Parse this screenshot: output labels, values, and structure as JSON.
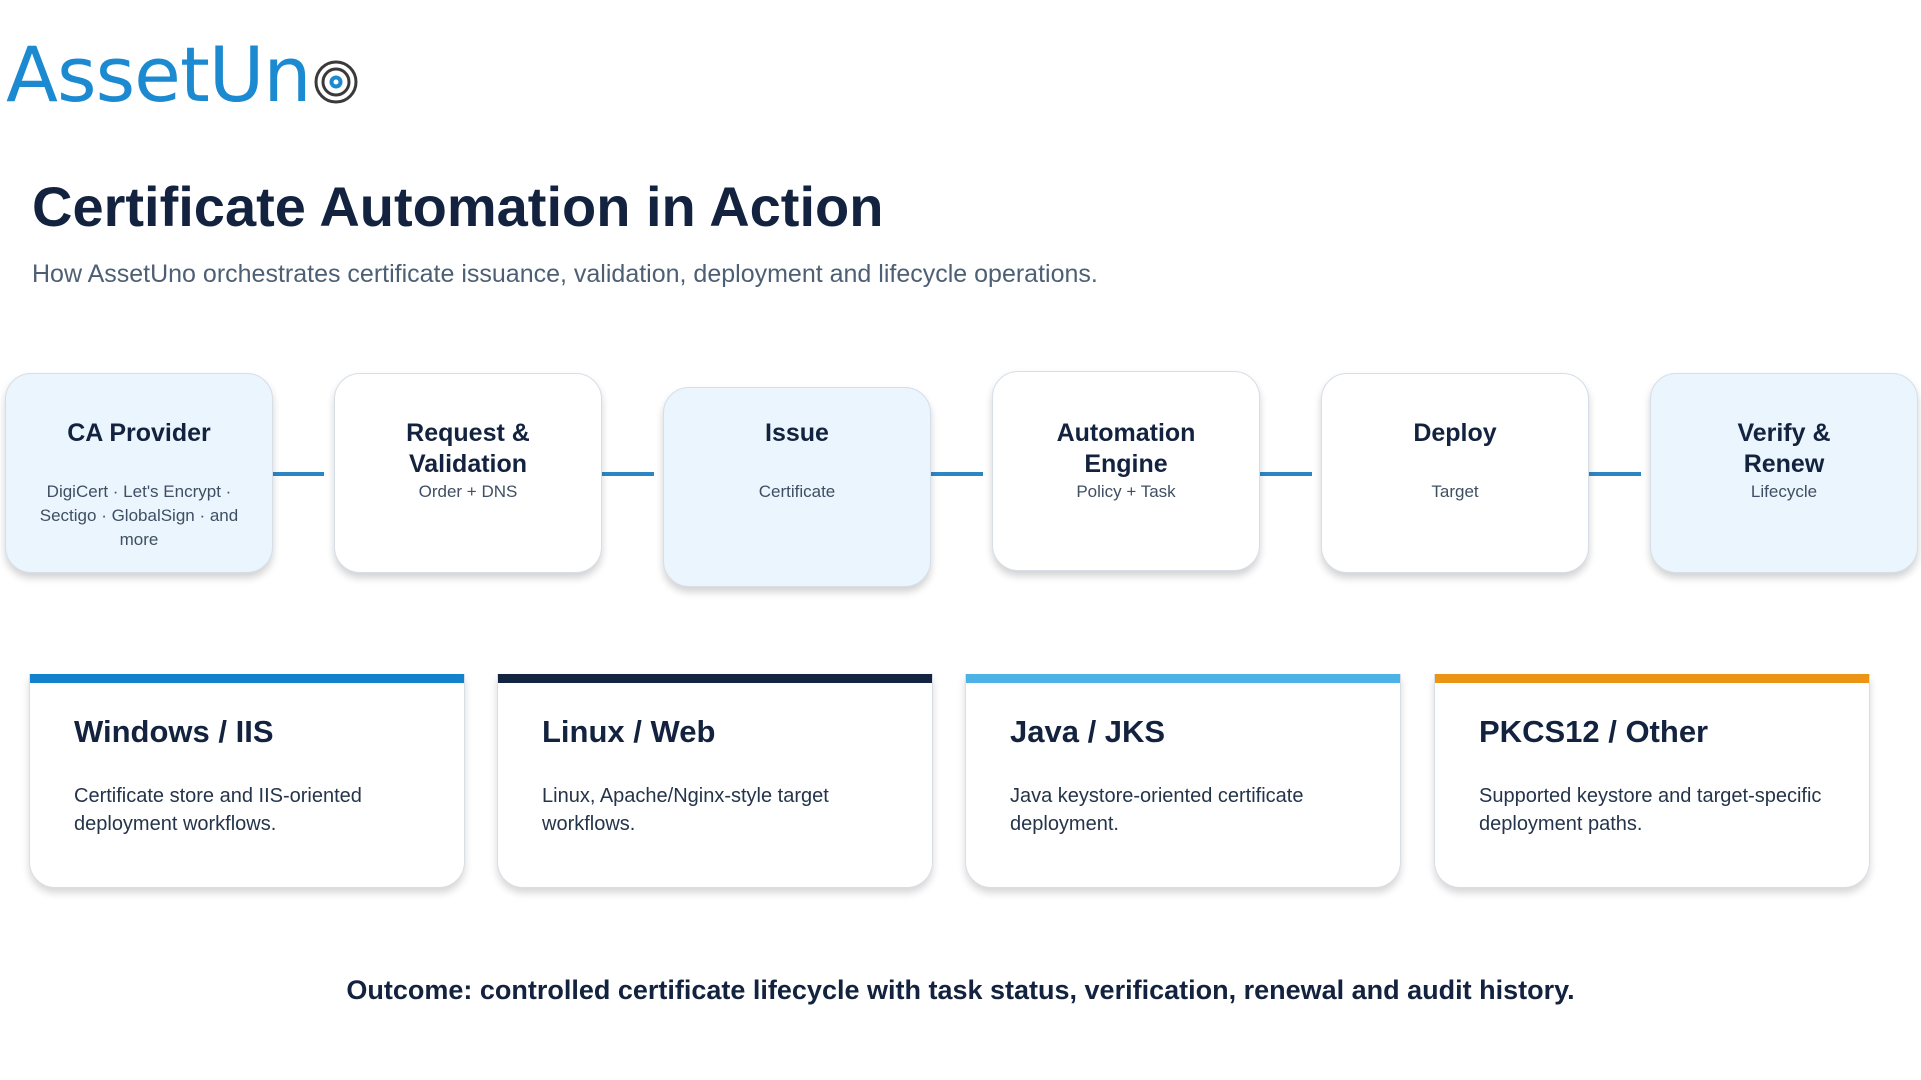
{
  "brand": {
    "logo_text": "AssetUn",
    "logo_mark_icon": "target-rings-icon",
    "logo_color": "#1b8ad0"
  },
  "header": {
    "title": "Certificate Automation in Action",
    "subtitle": "How AssetUno orchestrates certificate issuance, validation, deployment and lifecycle operations."
  },
  "flow": {
    "connector_color": "#2d86c4",
    "steps": [
      {
        "title": "CA Provider",
        "desc": "DigiCert · Let's Encrypt · Sectigo · GlobalSign · and more"
      },
      {
        "title": "Request & Validation",
        "desc": "Order + DNS"
      },
      {
        "title": "Issue",
        "desc": "Certificate"
      },
      {
        "title": "Automation Engine",
        "desc": "Policy + Task"
      },
      {
        "title": "Deploy",
        "desc": "Target"
      },
      {
        "title": "Verify & Renew",
        "desc": "Lifecycle"
      }
    ]
  },
  "platforms": [
    {
      "title": "Windows / IIS",
      "desc": "Certificate store and IIS-oriented deployment workflows.",
      "accent": "#1282cc"
    },
    {
      "title": "Linux / Web",
      "desc": "Linux, Apache/Nginx-style target workflows.",
      "accent": "#132440"
    },
    {
      "title": "Java / JKS",
      "desc": "Java keystore-oriented certificate deployment.",
      "accent": "#4db3e6"
    },
    {
      "title": "PKCS12 / Other",
      "desc": "Supported keystore and target-specific deployment paths.",
      "accent": "#ec9514"
    }
  ],
  "outcome": "Outcome: controlled certificate lifecycle with task status, verification, renewal and audit history."
}
